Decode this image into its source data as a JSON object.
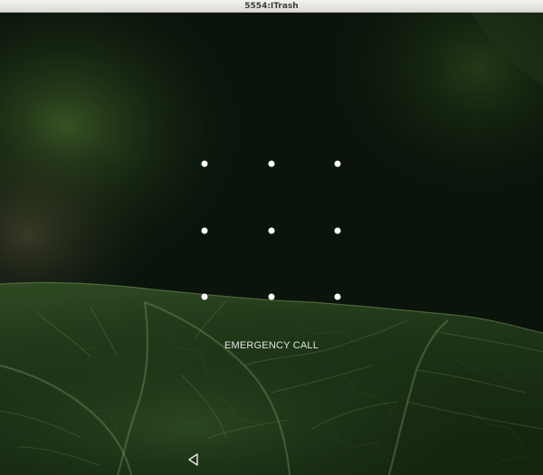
{
  "window": {
    "title": "5554:ITrash"
  },
  "lockscreen": {
    "pattern_dots_count": 9,
    "emergency_call_label": "EMERGENCY CALL"
  },
  "navigation": {
    "back_icon": "back-triangle-icon"
  },
  "colors": {
    "dot": "#ffffff",
    "text": "#e2e6e0",
    "wallpaper_dark": "#081008",
    "leaf_green": "#2a4a1c"
  }
}
